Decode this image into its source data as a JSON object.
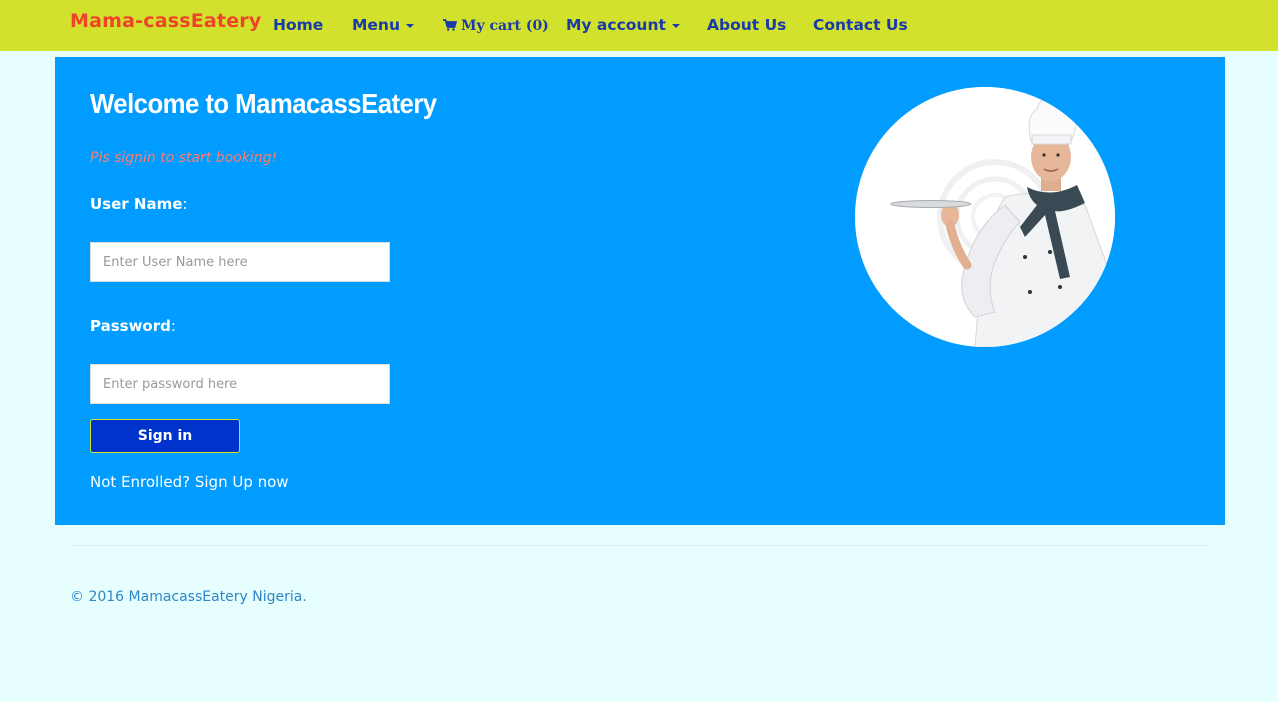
{
  "navbar": {
    "brand": "Mama-cassEatery",
    "items": [
      {
        "label": "Home"
      },
      {
        "label": "Menu"
      },
      {
        "label": "My cart (0)"
      },
      {
        "label": "My account"
      },
      {
        "label": "About Us"
      },
      {
        "label": "Contact Us"
      }
    ]
  },
  "login": {
    "title": "Welcome to MamacassEatery",
    "prompt": "Pls signin to start booking!",
    "username_label": "User Name",
    "username_placeholder": "Enter User Name here",
    "password_label": "Password",
    "password_placeholder": "Enter password here",
    "signin_label": "Sign in",
    "signup_link": "Not Enrolled? Sign Up now"
  },
  "footer": {
    "copyright": "© 2016 MamacassEatery Nigeria."
  },
  "colors": {
    "navbar_bg": "#d2e22c",
    "panel_bg": "#009cff",
    "page_bg": "#e6fffe",
    "brand": "#f0442a",
    "nav_link": "#1a3aa8",
    "button_bg": "#0033cc"
  },
  "icons": {
    "cart": "shopping-cart-icon",
    "dropdown": "caret-down-icon"
  }
}
